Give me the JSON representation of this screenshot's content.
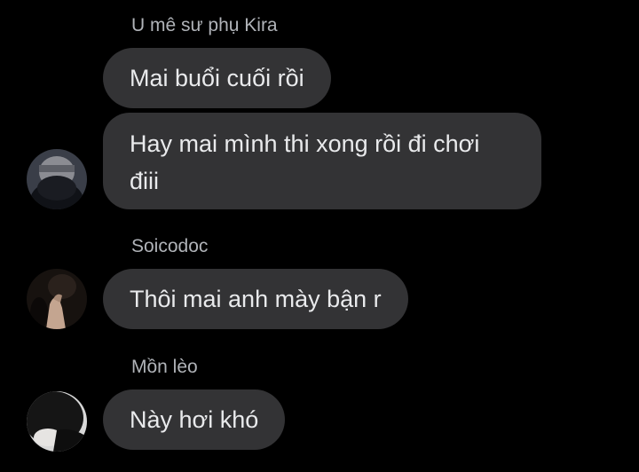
{
  "groups": [
    {
      "sender": "U mê sư phụ Kira",
      "messages": [
        "Mai buổi cuối rồi",
        "Hay mai mình thi xong rồi đi chơi điii"
      ],
      "avatar_icon": "masked-person-avatar"
    },
    {
      "sender": "Soicodoc",
      "messages": [
        "Thôi mai anh mày bận r"
      ],
      "avatar_icon": "hand-selfie-avatar"
    },
    {
      "sender": "Mồn lèo",
      "messages": [
        "Này hơi khó"
      ],
      "avatar_icon": "dark-hair-avatar"
    }
  ],
  "colors": {
    "background": "#000000",
    "bubble": "#333335",
    "bubble_text": "#e9eaec",
    "sender_text": "#b0b3b8"
  }
}
